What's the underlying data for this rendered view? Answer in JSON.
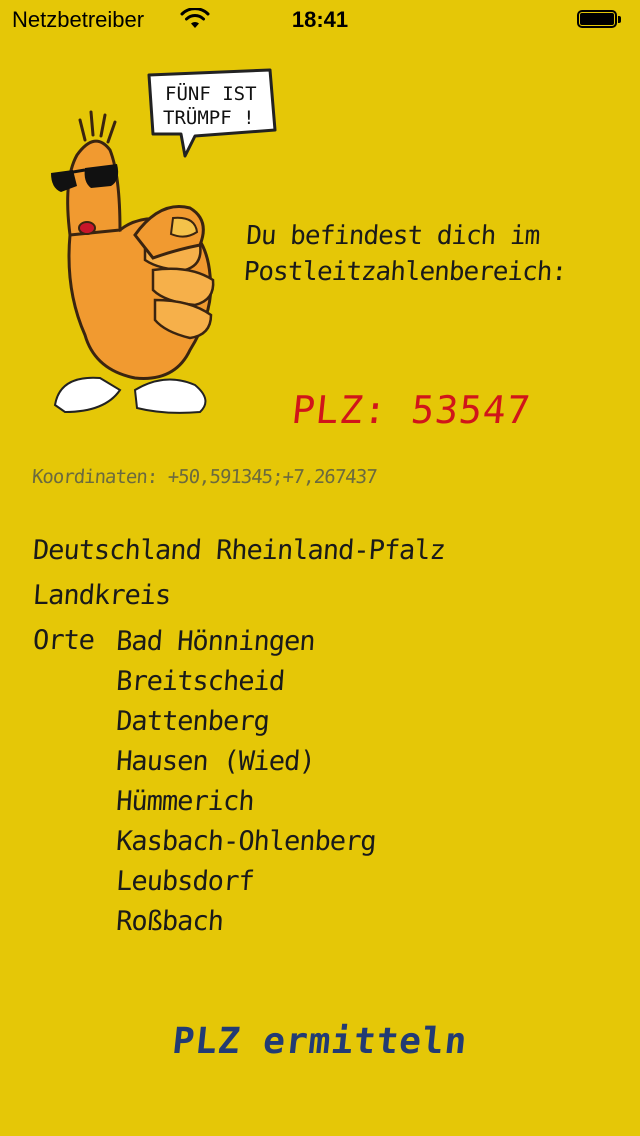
{
  "status_bar": {
    "carrier": "Netzbetreiber",
    "time": "18:41"
  },
  "mascot": {
    "speech_line1": "FÜNF IST",
    "speech_line2": "TRÜMPF !"
  },
  "intro": {
    "line1": "Du befindest dich im",
    "line2": "Postleitzahlenbereich:"
  },
  "plz": {
    "label": "PLZ:",
    "value": "53547"
  },
  "coordinates": {
    "label": "Koordinaten:",
    "value": "+50,591345;+7,267437"
  },
  "location": {
    "region": "Deutschland Rheinland-Pfalz",
    "kreis_label": "Landkreis",
    "orte_label": "Orte",
    "towns": [
      "Bad Hönningen",
      "Breitscheid",
      "Dattenberg",
      "Hausen (Wied)",
      "Hümmerich",
      "Kasbach-Ohlenberg",
      "Leubsdorf",
      "Roßbach"
    ]
  },
  "action": {
    "label": "PLZ ermitteln"
  },
  "colors": {
    "background": "#e5c707",
    "plz": "#d0151a",
    "button": "#223b74",
    "mascot": "#f19a30"
  }
}
